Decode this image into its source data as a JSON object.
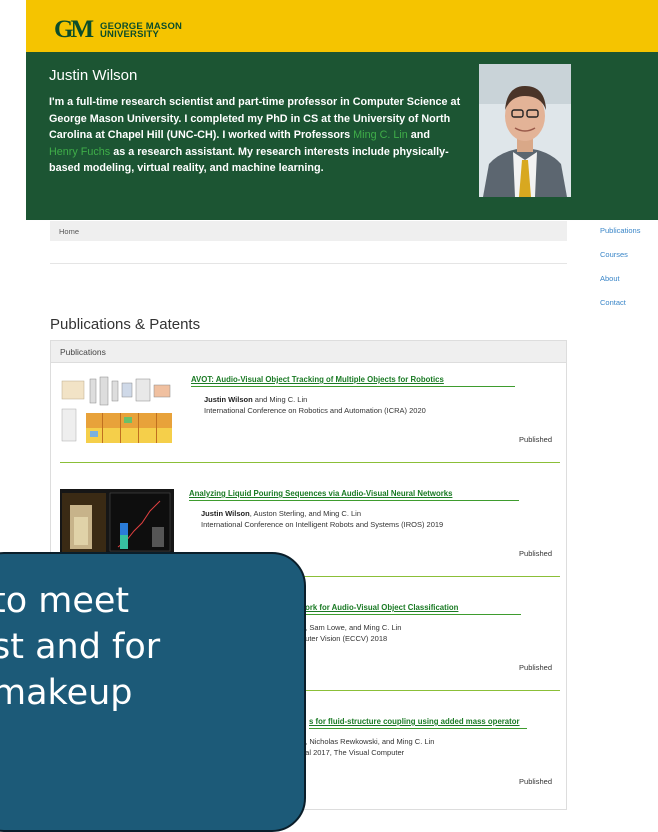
{
  "header": {
    "logo_mark": "GM",
    "logo_line1": "GEORGE MASON",
    "logo_line2": "UNIVERSITY",
    "logo_color": "#0b4d2a",
    "banner_color": "#f5c400"
  },
  "hero": {
    "name": "Justin Wilson",
    "bio_part1": "I'm a full-time research scientist and part-time professor in Computer Science at George Mason University. I completed my PhD in CS at the University of North Carolina at Chapel Hill (UNC-CH). I worked with Professors ",
    "link1": "Ming C. Lin",
    "bio_part2": " and ",
    "link2": "Henry Fuchs",
    "bio_part3": " as a research assistant. My research interests include physically-based modeling, virtual reality, and machine learning.",
    "background_color": "#1c5533",
    "link_color": "#3fae49"
  },
  "breadcrumb": {
    "home": "Home"
  },
  "sidenav": [
    "Publications",
    "Courses",
    "About",
    "Contact"
  ],
  "section": {
    "title": "Publications & Patents",
    "panel_title": "Publications"
  },
  "publications": [
    {
      "title": "AVOT: Audio-Visual Object Tracking of Multiple Objects for Robotics",
      "authors_bold": "Justin Wilson",
      "authors_rest": " and Ming C. Lin",
      "venue": "International Conference on Robotics and Automation (ICRA) 2020",
      "status": "Published"
    },
    {
      "title": "Analyzing Liquid Pouring Sequences via Audio-Visual Neural Networks",
      "authors_bold": "Justin Wilson",
      "authors_rest": ", Auston Sterling, and Ming C. Lin",
      "venue": "International Conference on Intelligent Robots and Systems (IROS) 2019",
      "status": "Published"
    },
    {
      "title": "work for Audio-Visual Object Classification",
      "authors_bold": "",
      "authors_rest": "n, Sam Lowe, and Ming C. Lin",
      "venue": "puter Vision (ECCV) 2018",
      "status": "Published"
    },
    {
      "title": "s for fluid-structure coupling using added mass operator",
      "authors_bold": "",
      "authors_rest": "g, Nicholas Rewkowski, and Ming C. Lin",
      "venue": "nal 2017, The Visual Computer",
      "status": "Published"
    }
  ],
  "overlay": {
    "line1": "to meet",
    "line2": "st and for",
    "line3": "makeup",
    "color": "#1c5a78"
  }
}
